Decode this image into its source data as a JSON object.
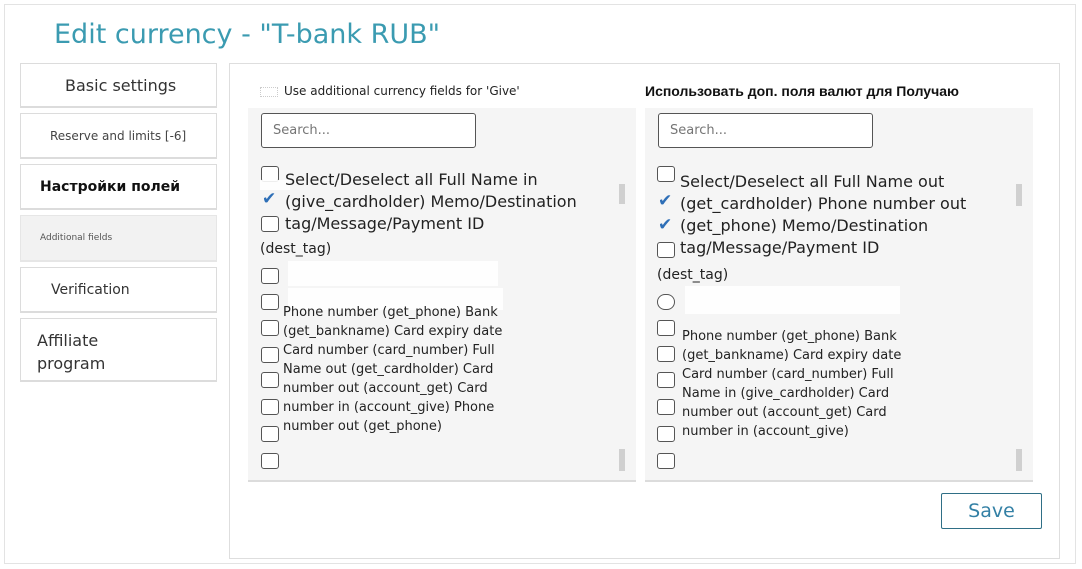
{
  "page": {
    "title": "Edit currency - \"T-bank RUB\""
  },
  "sidebar": {
    "items": [
      {
        "label": "Basic settings"
      },
      {
        "label": "Reserve and limits [-6]"
      },
      {
        "label": "Настройки полей"
      },
      {
        "label": "Additional fields"
      },
      {
        "label": "Verification"
      },
      {
        "label": "Affiliate program"
      }
    ]
  },
  "give": {
    "header": "Use additional currency fields for 'Give'",
    "search_placeholder": "Search...",
    "lines_big": [
      "Select/Deselect all Full Name in",
      "(give_cardholder) Memo/Destination",
      "tag/Message/Payment ID",
      "(dest_tag)"
    ],
    "lines_small": [
      "Phone number (get_phone) Bank",
      "(get_bankname) Card expiry date",
      "Card number (card_number) Full",
      "Name out (get_cardholder) Card",
      "number out (account_get) Card",
      "number in (account_give) Phone",
      "number out (get_phone)"
    ]
  },
  "get": {
    "header": "Использовать доп. поля валют для Получаю",
    "search_placeholder": "Search...",
    "lines_big": [
      "Select/Deselect all Full Name out",
      "(get_cardholder) Phone number out",
      "(get_phone) Memo/Destination",
      "tag/Message/Payment ID",
      "(dest_tag)"
    ],
    "lines_small": [
      "Phone number (get_phone) Bank",
      "(get_bankname) Card expiry date",
      "Card number (card_number) Full",
      "Name in (give_cardholder) Card",
      "number out (account_get) Card",
      "number in (account_give)"
    ]
  },
  "actions": {
    "save_label": "Save"
  },
  "colors": {
    "title": "#3b9bb1",
    "check": "#2e6fb7",
    "button_border": "#2f6f86"
  }
}
